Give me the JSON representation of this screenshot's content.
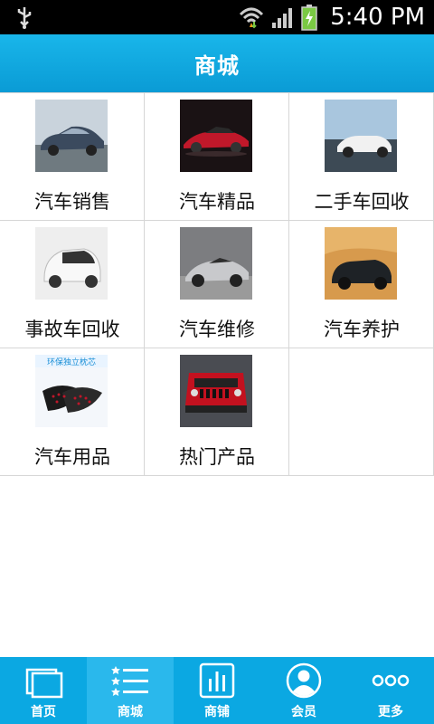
{
  "status_bar": {
    "time": "5:40 PM",
    "icons": [
      "usb-icon",
      "wifi-icon",
      "signal-icon",
      "battery-charging-icon"
    ]
  },
  "header": {
    "title": "商城"
  },
  "grid": {
    "items": [
      {
        "label": "汽车销售",
        "icon": "sedan-car-image"
      },
      {
        "label": "汽车精品",
        "icon": "red-sports-car-image"
      },
      {
        "label": "二手车回收",
        "icon": "white-convertible-image"
      },
      {
        "label": "事故车回收",
        "icon": "white-compact-car-image"
      },
      {
        "label": "汽车维修",
        "icon": "silver-coupe-image"
      },
      {
        "label": "汽车养护",
        "icon": "suv-desert-image"
      },
      {
        "label": "汽车用品",
        "icon": "car-pillow-image",
        "overlay_text": "环保独立枕芯"
      },
      {
        "label": "热门产品",
        "icon": "red-jeep-image"
      }
    ]
  },
  "tabbar": {
    "active_index": 1,
    "tabs": [
      {
        "label": "首页",
        "icon": "home-icon"
      },
      {
        "label": "商城",
        "icon": "list-icon"
      },
      {
        "label": "商铺",
        "icon": "shop-chart-icon"
      },
      {
        "label": "会员",
        "icon": "member-icon"
      },
      {
        "label": "更多",
        "icon": "more-icon"
      }
    ]
  },
  "colors": {
    "header_bg": "#0aa9e3",
    "tabbar_bg": "#0ba8e2",
    "tab_active_bg": "#2ab8ec",
    "divider": "#d6d6d6"
  }
}
